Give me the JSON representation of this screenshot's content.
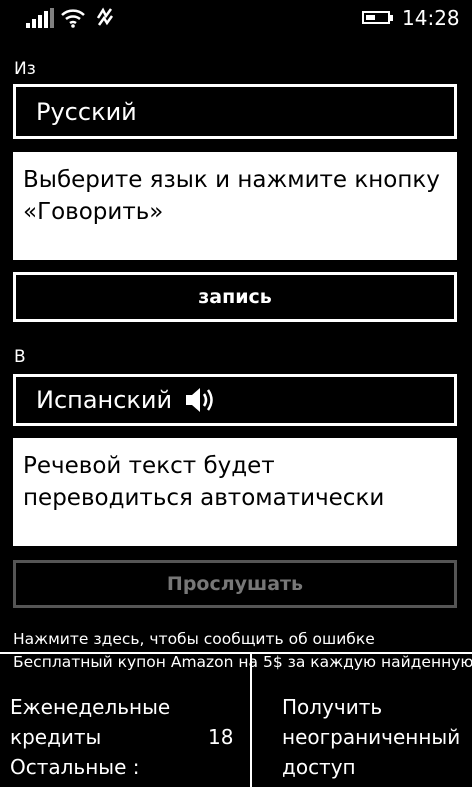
{
  "status_bar": {
    "time": "14:28",
    "signal_icon": "signal-bars-icon",
    "wifi_icon": "wifi-icon",
    "network_icon": "data-network-icon",
    "battery_icon": "battery-icon",
    "battery_level": 0.45
  },
  "from": {
    "label": "Из",
    "language": "Русский",
    "text": "Выберите язык и нажмите кнопку «Говорить»"
  },
  "record_button": "запись",
  "to": {
    "label": "В",
    "language": "Испанский",
    "speaker_icon": "speaker-icon",
    "text": "Речевой текст будет переводиться автоматически"
  },
  "listen_button": "Прослушать",
  "links": {
    "report_error": "Нажмите здесь, чтобы сообщить об ошибке",
    "coupon": "Бесплатный купон Amazon на 5$ за каждую найденную"
  },
  "credits": {
    "label_line1": "Еженедельные",
    "label_line2": "кредиты",
    "value": "18",
    "label_line3": "Остальные :"
  },
  "unlimited": {
    "line1": "Получить",
    "line2": "неограниченный",
    "line3": "доступ"
  }
}
